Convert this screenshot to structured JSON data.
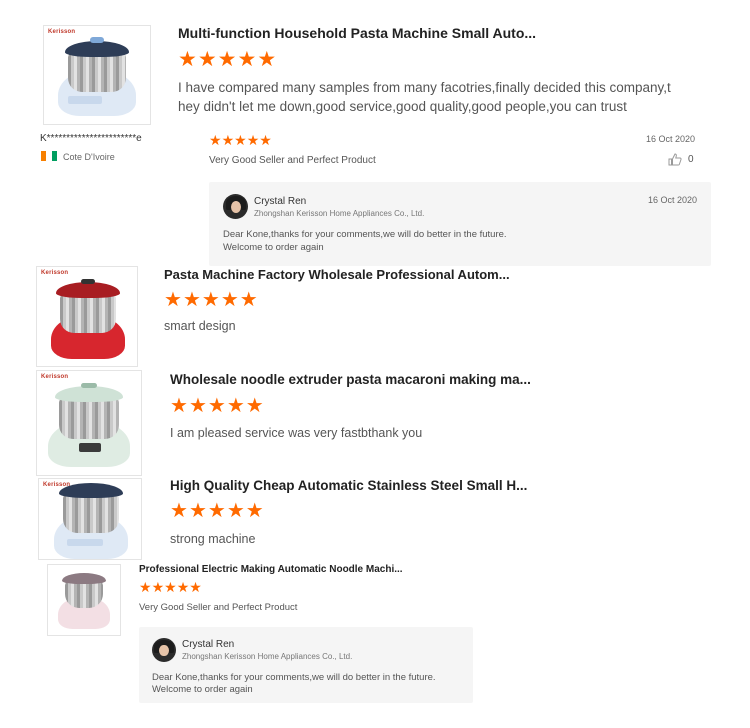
{
  "thumbnail_brand": "Kerisson",
  "reviews": [
    {
      "title": "Multi-function Household Pasta Machine Small Auto...",
      "stars": 5,
      "text_line1": "I have compared many samples from many facotries,finally decided this company,t",
      "text_line2": "hey didn't let me down,good service,good quality,good people,you can trust"
    },
    {
      "title": "Pasta Machine Factory Wholesale Professional Autom...",
      "stars": 5,
      "text": "smart design"
    },
    {
      "title": "Wholesale noodle extruder pasta macaroni making ma...",
      "stars": 5,
      "text": "I am pleased service was very fastbthank you"
    },
    {
      "title": "High Quality Cheap Automatic Stainless Steel Small H...",
      "stars": 5,
      "text": "strong machine"
    },
    {
      "title": "Professional Electric Making Automatic Noodle Machi...",
      "stars": 5,
      "text": "Very Good Seller and Perfect Product"
    }
  ],
  "buyer": {
    "name": "K***********************e",
    "country": "Cote D'Ivoire",
    "stars": 5,
    "date": "16 Oct 2020",
    "comment": "Very Good Seller and Perfect Product",
    "likes": "0"
  },
  "reply": {
    "name": "Crystal Ren",
    "company": "Zhongshan Kerisson Home Appliances Co., Ltd.",
    "date": "16 Oct 2020",
    "line1": "Dear Kone,thanks for your comments,we will do better in the future.",
    "line2": "Welcome to order again"
  },
  "colors": {
    "star": "#ff6a00",
    "flag_orange": "#f77f00",
    "flag_white": "#ffffff",
    "flag_green": "#009e60"
  },
  "icons": [
    "star-icon",
    "thumbs-up-icon",
    "flag-icon",
    "avatar"
  ]
}
